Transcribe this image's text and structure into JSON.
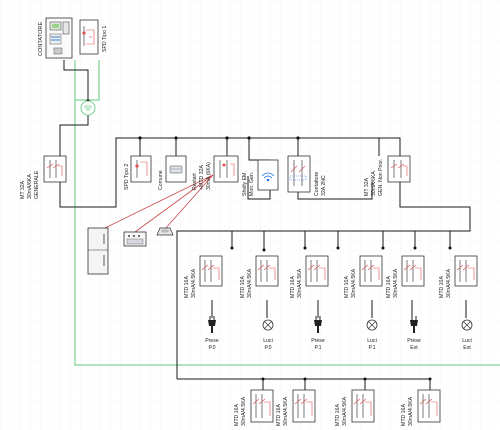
{
  "contatore": {
    "title": "CONTATORE"
  },
  "spd1": {
    "label": "SPD Tipo 1"
  },
  "mt_generale": {
    "line1": "MT 32A",
    "line2": "30mA/6KA",
    "line3": "GENERALE"
  },
  "spd2": {
    "label": "SPD Tipo 2"
  },
  "comune": {
    "label": "Comune"
  },
  "restart": {
    "line1": "Restart",
    "line2": "+MTD 32A",
    "line3": "30mA (6KA)"
  },
  "shelly": {
    "line1": "Shelly EM",
    "line2": "Mon. Gen."
  },
  "contattore": {
    "line1": "Contattore",
    "line2": "32A 2NC"
  },
  "mt_nonprior": {
    "line1": "MT 32A",
    "line2": "30mA/6KA",
    "line3": "GEN. Non Prior."
  },
  "circuits": [
    {
      "rating": "MTD 16A",
      "spec": "30mA/4.5KA",
      "load": "socket",
      "name1": "Prese",
      "name2": "P.0"
    },
    {
      "rating": "MTD 10A",
      "spec": "30mA/4.5KA",
      "load": "lamp",
      "name1": "Luci",
      "name2": "P.0"
    },
    {
      "rating": "MTD 16A",
      "spec": "30mA/4.5KA",
      "load": "socket",
      "name1": "Prese",
      "name2": "P.1"
    },
    {
      "rating": "MTD 10A",
      "spec": "30mA/4.5KA",
      "load": "lamp",
      "name1": "Luci",
      "name2": "P.1"
    },
    {
      "rating": "MTD 16A",
      "spec": "30mA/4.5KA",
      "load": "socket",
      "name1": "Prese",
      "name2": "Ext"
    },
    {
      "rating": "MTD 10A",
      "spec": "30mA/4.5KA",
      "load": "lamp",
      "name1": "Luci",
      "name2": "Ext"
    }
  ],
  "bottom_row": [
    {
      "rating": "MTD 16A",
      "spec": "30mA/4.5KA"
    },
    {
      "rating": "MTD 16A",
      "spec": "30mA/4.5KA"
    },
    {
      "rating": "MTD 16A",
      "spec": "30mA/4.5KA"
    },
    {
      "rating": "MTD 16A",
      "spec": "30mA/4.5KA"
    }
  ],
  "colors": {
    "wire": "#1a1a1a",
    "earth": "#5fc87e",
    "breaker_mark": "#e05050",
    "wireless": "#1e6fd9"
  },
  "icons": [
    "meter-icon",
    "breaker-icon",
    "socket-icon",
    "lamp-icon",
    "wifi-icon",
    "appliance-icon"
  ]
}
